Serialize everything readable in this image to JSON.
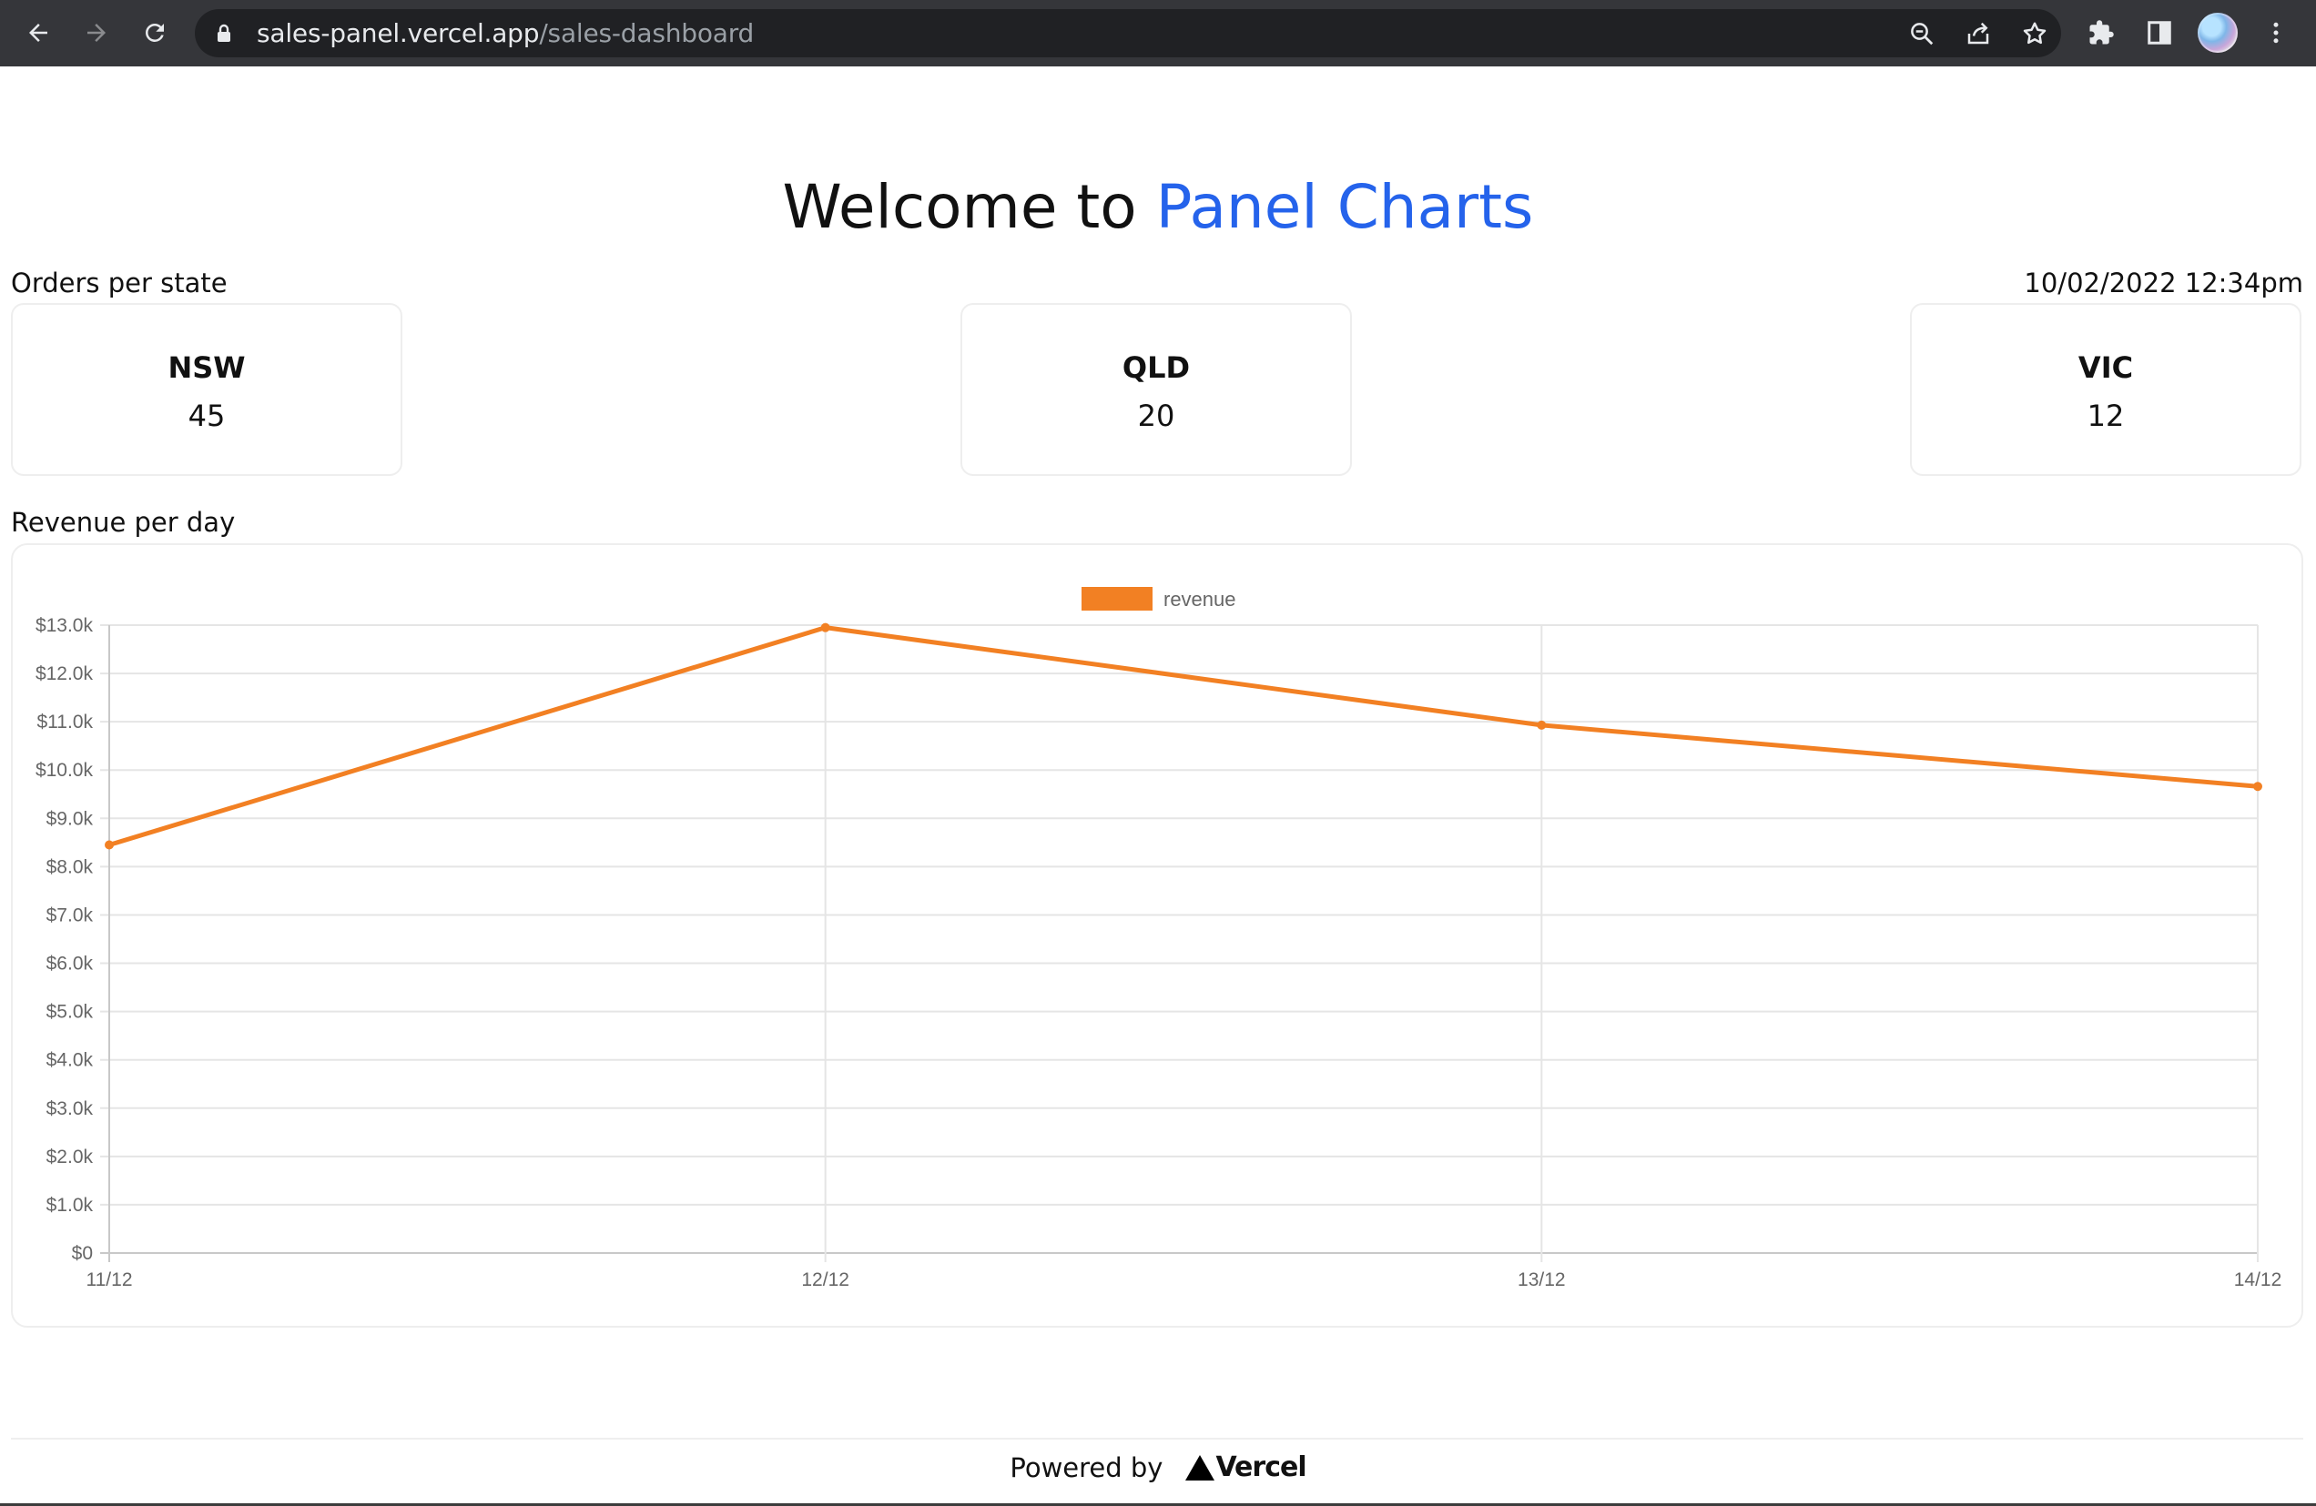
{
  "browser": {
    "url_host": "sales-panel.vercel.app",
    "url_path": "/sales-dashboard",
    "icons": [
      "back-arrow-icon",
      "forward-arrow-icon",
      "reload-icon",
      "lock-icon",
      "zoom-icon",
      "share-icon",
      "star-icon",
      "extensions-icon",
      "side-panel-icon",
      "avatar",
      "menu-dots-icon"
    ]
  },
  "page": {
    "title_prefix": "Welcome to",
    "title_accent": "Panel Charts",
    "accent_color": "#2563eb",
    "orders_label": "Orders per state",
    "timestamp": "10/02/2022 12:34pm",
    "states": [
      {
        "name": "NSW",
        "orders": "45"
      },
      {
        "name": "QLD",
        "orders": "20"
      },
      {
        "name": "VIC",
        "orders": "12"
      }
    ],
    "revenue_label": "Revenue per day"
  },
  "chart_data": {
    "type": "line",
    "x": [
      "11/12",
      "12/12",
      "13/12",
      "14/12"
    ],
    "series": [
      {
        "name": "revenue",
        "values": [
          8450,
          12950,
          10930,
          9660
        ],
        "color": "#f28023"
      }
    ],
    "ylim": [
      0,
      13000
    ],
    "yticks": [
      "$0",
      "$1.0k",
      "$2.0k",
      "$3.0k",
      "$4.0k",
      "$5.0k",
      "$6.0k",
      "$7.0k",
      "$8.0k",
      "$9.0k",
      "$10.0k",
      "$11.0k",
      "$12.0k",
      "$13.0k"
    ],
    "grid": true,
    "legend": "top-center"
  },
  "footer": {
    "powered_by": "Powered by",
    "brand": "Vercel"
  }
}
